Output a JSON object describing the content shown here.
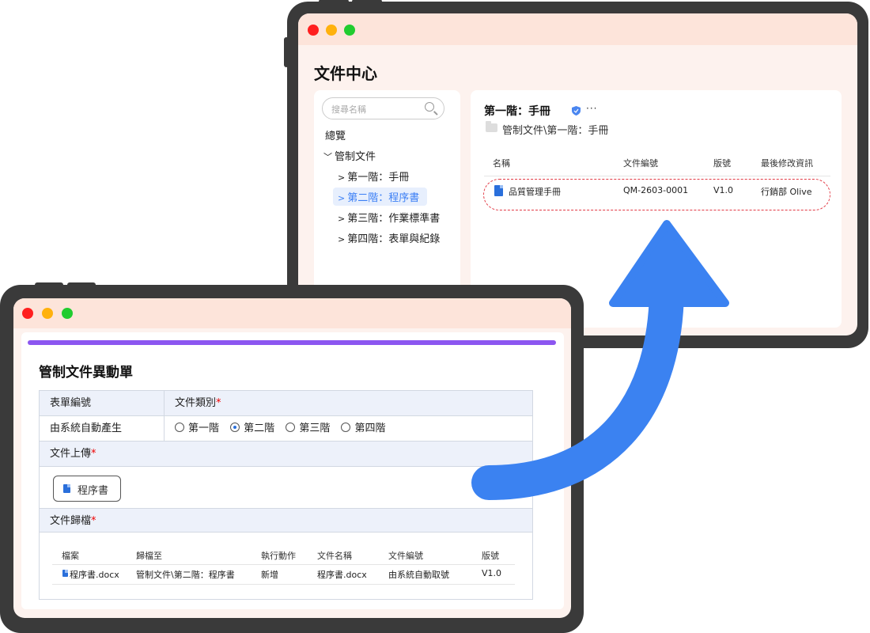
{
  "back_window": {
    "page_title": "文件中心",
    "search_placeholder": "搜尋名稱",
    "nav": {
      "overview": "總覽",
      "controlled_docs": "管制文件",
      "items": [
        "第一階：手冊",
        "第二階：程序書",
        "第三階：作業標準書",
        "第四階：表單與紀錄"
      ]
    },
    "folder": {
      "title": "第一階：手冊",
      "path": "管制文件\\第一階：手冊",
      "more": "···"
    },
    "table": {
      "headers": [
        "名稱",
        "文件編號",
        "版號",
        "最後修改資訊"
      ],
      "rows": [
        {
          "name": "品質管理手冊",
          "doc_no": "QM-2603-0001",
          "version": "V1.0",
          "modified": "行銷部 Olive"
        }
      ]
    }
  },
  "front_window": {
    "form_title": "管制文件異動單",
    "fields": {
      "form_no_label": "表單編號",
      "form_no_value": "由系統自動產生",
      "doc_type_label": "文件類別",
      "upload_label": "文件上傳",
      "archive_label": "文件歸檔",
      "required_mark": "*"
    },
    "doc_types": [
      "第一階",
      "第二階",
      "第三階",
      "第四階"
    ],
    "selected_doc_type": "第二階",
    "uploaded_file": "程序書",
    "archive_table": {
      "headers": [
        "檔案",
        "歸檔至",
        "執行動作",
        "文件名稱",
        "文件編號",
        "版號"
      ],
      "rows": [
        {
          "file": "程序書.docx",
          "target": "管制文件\\第二階：程序書",
          "action": "新增",
          "doc_name": "程序書.docx",
          "doc_no": "由系統自動取號",
          "version": "V1.0"
        }
      ]
    }
  },
  "colors": {
    "titlebar": "#fde4da",
    "accent_purple": "#8c56f0",
    "arrow_blue": "#3b82f1",
    "highlight_red": "#e23a45"
  }
}
